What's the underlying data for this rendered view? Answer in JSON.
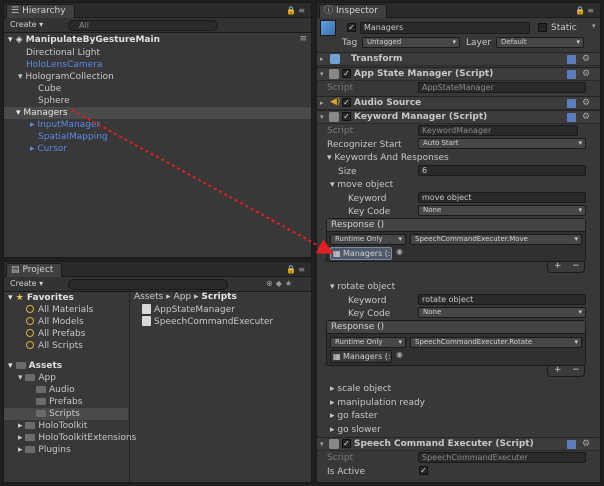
{
  "hierarchy": {
    "tab": "Hierarchy",
    "create": "Create",
    "search": "All",
    "scene": "ManipulateByGestureMain",
    "items": [
      "Directional Light",
      "HoloLensCamera",
      "HologramCollection",
      "Cube",
      "Sphere",
      "Managers",
      "InputManager",
      "SpatialMapping",
      "Cursor"
    ]
  },
  "project": {
    "tab": "Project",
    "create": "Create",
    "favorites": "Favorites",
    "fav_items": [
      "All Materials",
      "All Models",
      "All Prefabs",
      "All Scripts"
    ],
    "assets": "Assets",
    "tree": [
      "App",
      "Audio",
      "Prefabs",
      "Scripts",
      "HoloToolkit",
      "HoloToolkitExtensions",
      "Plugins"
    ],
    "breadcrumb": [
      "Assets",
      "App",
      "Scripts"
    ],
    "files": [
      "AppStateManager",
      "SpeechCommandExecuter"
    ]
  },
  "inspector": {
    "tab": "Inspector",
    "object_name": "Managers",
    "static_label": "Static",
    "tag_label": "Tag",
    "tag_value": "Untagged",
    "layer_label": "Layer",
    "layer_value": "Default",
    "transform": "Transform",
    "app_state": {
      "title": "App State Manager (Script)",
      "script_label": "Script",
      "script_value": "AppStateManager"
    },
    "audio": "Audio Source",
    "keyword": {
      "title": "Keyword Manager (Script)",
      "script_label": "Script",
      "script_value": "KeywordManager",
      "recognizer_label": "Recognizer Start",
      "recognizer_value": "Auto Start",
      "kr_label": "Keywords And Responses",
      "size_label": "Size",
      "size_value": "6",
      "move": {
        "header": "move object",
        "keyword_label": "Keyword",
        "keyword_value": "move object",
        "keycode_label": "Key Code",
        "keycode_value": "None",
        "response": "Response ()",
        "runtime": "Runtime Only",
        "function": "SpeechCommandExecuter.Move",
        "object": "Managers (:"
      },
      "rotate": {
        "header": "rotate object",
        "keyword_label": "Keyword",
        "keyword_value": "rotate object",
        "keycode_label": "Key Code",
        "keycode_value": "None",
        "response": "Response ()",
        "runtime": "Runtime Only",
        "function": "SpeechCommandExecuter.Rotate",
        "object": "Managers (:"
      },
      "collapsed": [
        "scale object",
        "manipulation ready",
        "go faster",
        "go slower"
      ]
    },
    "speech": {
      "title": "Speech Command Executer (Script)",
      "script_label": "Script",
      "script_value": "SpeechCommandExecuter",
      "active_label": "Is Active"
    }
  },
  "colors": {
    "arrow": "#e02020",
    "link": "#5c8ae6"
  }
}
